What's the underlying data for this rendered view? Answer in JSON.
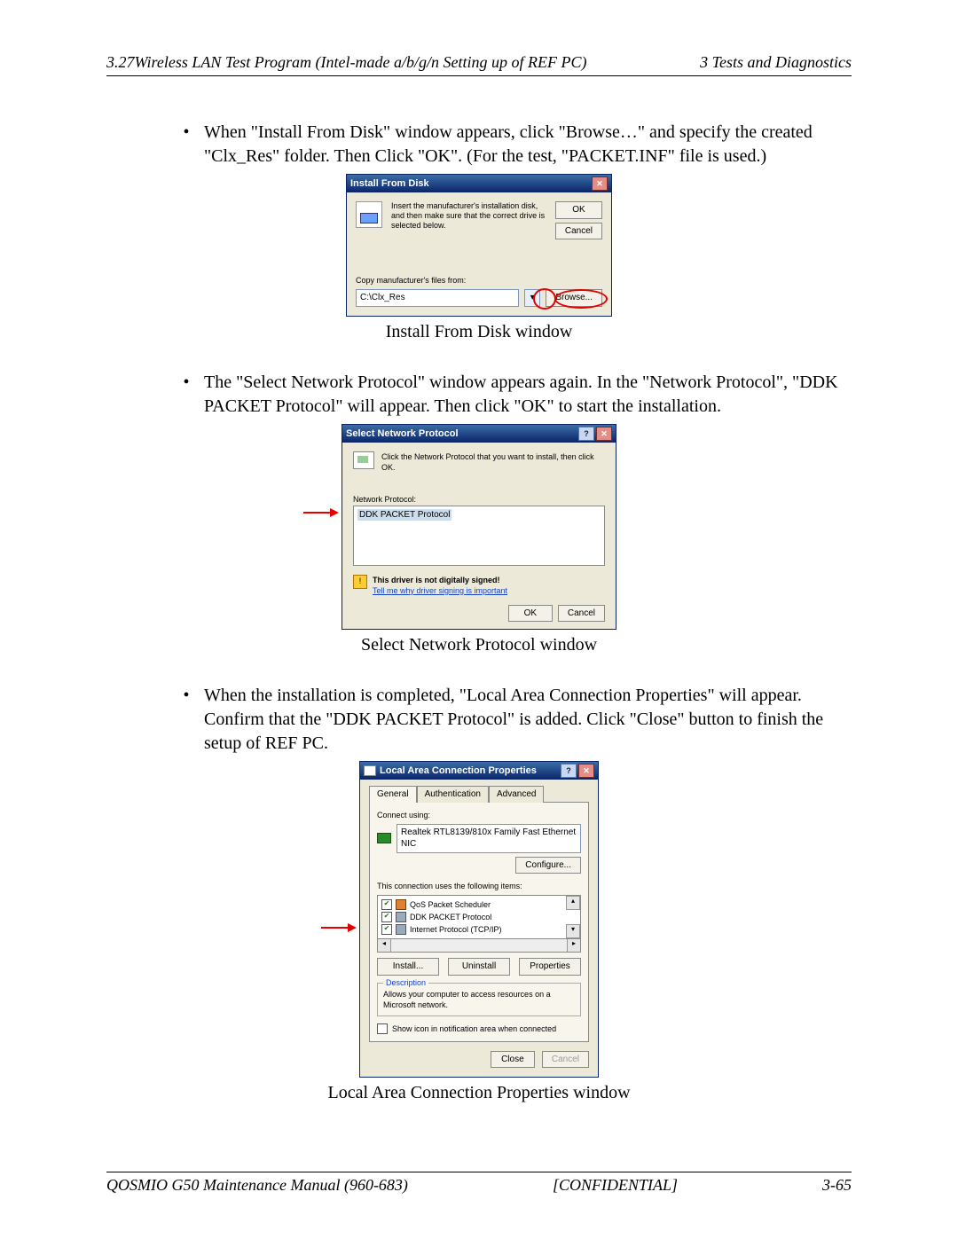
{
  "header": {
    "left": "3.27Wireless LAN Test Program (Intel-made a/b/g/n Setting up of REF PC)",
    "right": "3  Tests and Diagnostics"
  },
  "bullets": {
    "b1": "When \"Install From Disk\" window appears, click \"Browse…\" and specify the created \"Clx_Res\" folder. Then Click \"OK\". (For the test, \"PACKET.INF\" file is used.)",
    "b2": "The \"Select Network Protocol\" window appears again. In the \"Network Protocol\", \"DDK PACKET Protocol\" will appear. Then click \"OK\" to start the installation.",
    "b3": "When the installation is completed, \"Local Area Connection Properties\" will appear. Confirm that the \"DDK PACKET Protocol\" is added. Click \"Close\" button to finish the setup of REF PC."
  },
  "captions": {
    "c1": "Install From Disk window",
    "c2": "Select Network Protocol window",
    "c3": "Local Area Connection Properties window"
  },
  "dlg1": {
    "title": "Install From Disk",
    "msg": "Insert the manufacturer's installation disk, and then make sure that the correct drive is selected below.",
    "ok": "OK",
    "cancel": "Cancel",
    "copy_label": "Copy manufacturer's files from:",
    "path": "C:\\Clx_Res",
    "browse": "Browse..."
  },
  "dlg2": {
    "title": "Select Network Protocol",
    "msg": "Click the Network Protocol that you want to install, then click OK.",
    "list_label": "Network Protocol:",
    "item": "DDK PACKET Protocol",
    "warn_bold": "This driver is not digitally signed!",
    "warn_link": "Tell me why driver signing is important",
    "ok": "OK",
    "cancel": "Cancel"
  },
  "dlg3": {
    "title": "Local Area Connection Properties",
    "tabs": {
      "general": "General",
      "auth": "Authentication",
      "adv": "Advanced"
    },
    "connect_using": "Connect using:",
    "adapter": "Realtek RTL8139/810x Family Fast Ethernet NIC",
    "configure": "Configure...",
    "items_label": "This connection uses the following items:",
    "items": {
      "i1": "QoS Packet Scheduler",
      "i2": "DDK PACKET Protocol",
      "i3": "Internet Protocol (TCP/IP)"
    },
    "install": "Install...",
    "uninstall": "Uninstall",
    "properties": "Properties",
    "desc_title": "Description",
    "desc_text": "Allows your computer to access resources on a Microsoft network.",
    "show_icon": "Show icon in notification area when connected",
    "close": "Close",
    "cancel": "Cancel"
  },
  "footer": {
    "left": "QOSMIO G50 Maintenance Manual (960-683)",
    "center": "[CONFIDENTIAL]",
    "right": "3-65"
  }
}
